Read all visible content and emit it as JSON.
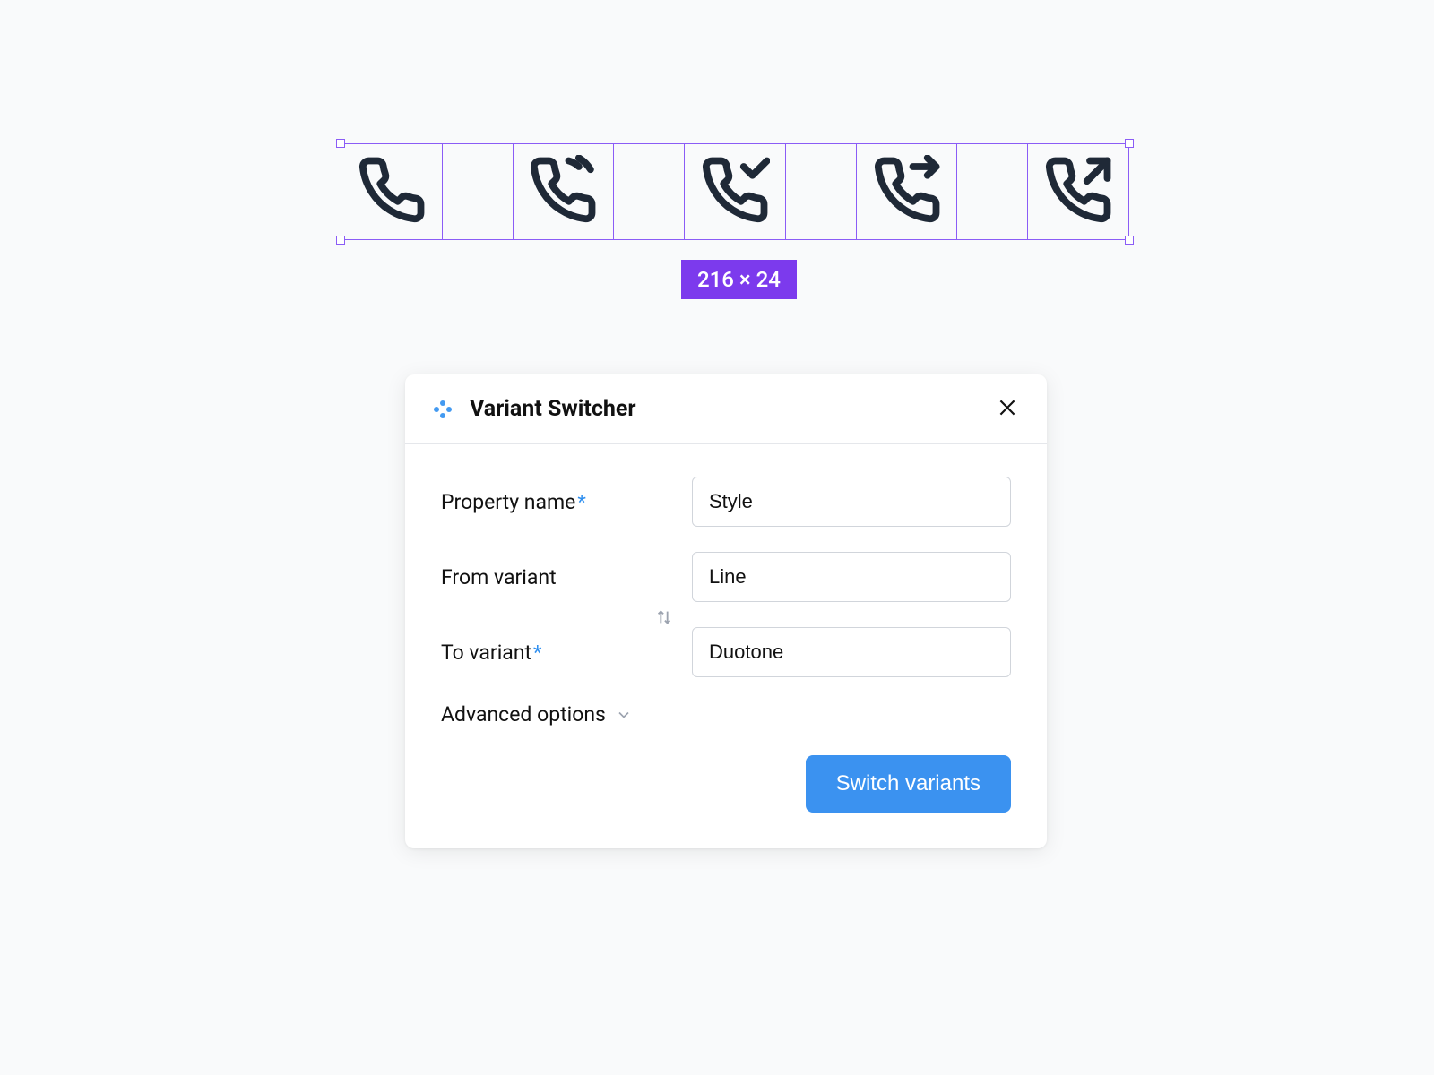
{
  "canvas": {
    "selection_dimensions": "216 × 24",
    "icons": [
      {
        "name": "phone"
      },
      {
        "name": "phone-ringing"
      },
      {
        "name": "phone-check"
      },
      {
        "name": "phone-forward"
      },
      {
        "name": "phone-outgoing"
      }
    ]
  },
  "modal": {
    "title": "Variant Switcher",
    "fields": {
      "property_name": {
        "label": "Property name",
        "required": true,
        "value": "Style"
      },
      "from_variant": {
        "label": "From variant",
        "required": false,
        "value": "Line"
      },
      "to_variant": {
        "label": "To variant",
        "required": true,
        "value": "Duotone"
      }
    },
    "advanced_label": "Advanced options",
    "submit_label": "Switch variants"
  },
  "colors": {
    "selection_border": "#8b5cf6",
    "badge_bg": "#7c3aed",
    "primary_button": "#3b92f0",
    "required": "#2f8fef"
  }
}
